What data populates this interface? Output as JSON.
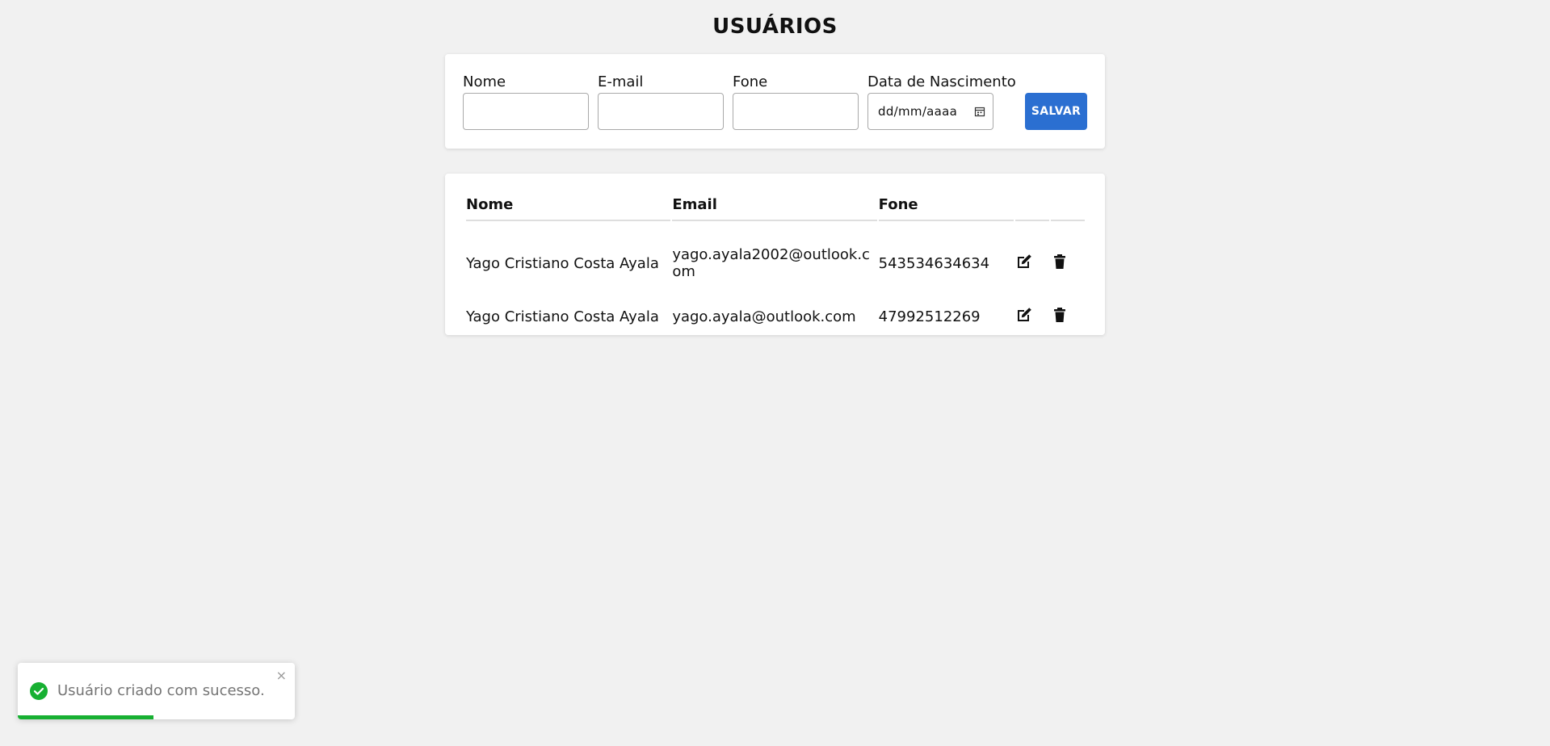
{
  "page": {
    "title": "USUÁRIOS"
  },
  "form": {
    "nome_label": "Nome",
    "nome_value": "",
    "email_label": "E-mail",
    "email_value": "",
    "fone_label": "Fone",
    "fone_value": "",
    "nascimento_label": "Data de Nascimento",
    "nascimento_placeholder": "dd/mm/aaaa",
    "save_label": "SALVAR"
  },
  "table": {
    "headers": [
      "Nome",
      "Email",
      "Fone",
      "",
      ""
    ],
    "rows": [
      {
        "nome": "Yago Cristiano Costa Ayala",
        "email": "yago.ayala2002@outlook.com",
        "fone": "543534634634"
      },
      {
        "nome": "Yago Cristiano Costa Ayala",
        "email": "yago.ayala@outlook.com",
        "fone": "47992512269"
      }
    ],
    "row_actions": [
      "edit-icon",
      "trash-icon"
    ]
  },
  "toast": {
    "message": "Usuário criado com sucesso.",
    "close_glyph": "×",
    "progress_percent": 49,
    "icon": "check-circle-icon",
    "accent_color": "#17b032"
  },
  "colors": {
    "background": "#f1f1f1",
    "primary_button": "#2b6fd1",
    "success": "#17b032"
  }
}
